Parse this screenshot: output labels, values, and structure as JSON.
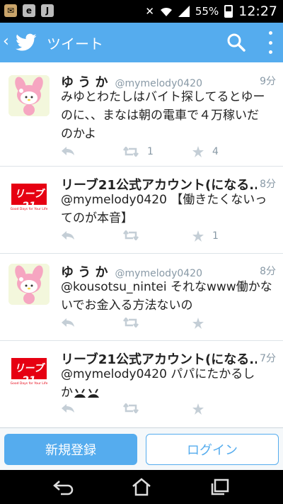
{
  "status_bar": {
    "left_icons": [
      "notification-icon",
      "e-icon",
      "j-icon"
    ],
    "battery": "55%",
    "time": "12:27"
  },
  "app_bar": {
    "title": "ツイート"
  },
  "tweets": [
    {
      "name": "ゆ う か",
      "handle": "@mymelody0420",
      "time": "9分",
      "text_lines": [
        "みゆとわたしはバイト探してるとゆー",
        "のに、、まなは朝の電車で４万稼いだ",
        "のかよ"
      ],
      "retweets": "1",
      "favorites": "4",
      "avatar": "my-melody-avatar"
    },
    {
      "name": "リーブ21公式アカウント(になる...",
      "handle": "",
      "time": "8分",
      "text_lines": [
        "@mymelody0420 【働きたくないっ",
        "てのが本音】"
      ],
      "retweets": "",
      "favorites": "1",
      "avatar": "reve21-logo-avatar",
      "logo_text": "リーブ21",
      "logo_tagline": "Good Days for Your Life"
    },
    {
      "name": "ゆ う か",
      "handle": "@mymelody0420",
      "time": "8分",
      "text_lines": [
        "@kousotsu_nintei それなwww働かな",
        "いでお金入る方法ないの"
      ],
      "retweets": "",
      "favorites": "",
      "avatar": "my-melody-avatar"
    },
    {
      "name": "リーブ21公式アカウント(になる...",
      "handle": "",
      "time": "7分",
      "text_lines": [
        "@mymelody0420 パパにたかるし",
        "か"
      ],
      "retweets": "",
      "favorites": "",
      "avatar": "reve21-logo-avatar",
      "logo_text": "リーブ21",
      "logo_tagline": "Good Days for Your Life"
    }
  ],
  "bottom": {
    "signup_label": "新規登録",
    "login_label": "ログイン"
  },
  "colors": {
    "twitter_blue": "#55acee",
    "reve_red": "#e60012"
  }
}
